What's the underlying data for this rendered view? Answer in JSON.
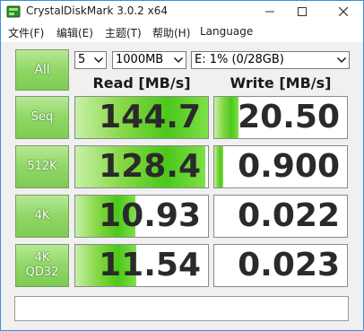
{
  "window": {
    "title": "CrystalDiskMark 3.0.2 x64"
  },
  "menu": [
    {
      "label": "文件(F)"
    },
    {
      "label": "编辑(E)"
    },
    {
      "label": "主题(T)"
    },
    {
      "label": "帮助(H)"
    },
    {
      "label": "Language"
    }
  ],
  "controls": {
    "all_button": "All",
    "count": "5",
    "size": "1000MB",
    "drive": "E: 1% (0/28GB)"
  },
  "columns": {
    "read": "Read [MB/s]",
    "write": "Write [MB/s]"
  },
  "rows": [
    {
      "label_line1": "Seq",
      "label_line2": "",
      "read": "144.7",
      "write": "20.50",
      "read_fill_pct": 100,
      "write_fill_pct": 18
    },
    {
      "label_line1": "512K",
      "label_line2": "",
      "read": "128.4",
      "write": "0.900",
      "read_fill_pct": 98,
      "write_fill_pct": 7
    },
    {
      "label_line1": "4K",
      "label_line2": "",
      "read": "10.93",
      "write": "0.022",
      "read_fill_pct": 45,
      "write_fill_pct": 0
    },
    {
      "label_line1": "4K",
      "label_line2": "QD32",
      "read": "11.54",
      "write": "0.023",
      "read_fill_pct": 46,
      "write_fill_pct": 0
    }
  ],
  "status_text": "",
  "colors": {
    "accent_green": "#4cc81a",
    "window_border": "#3c8fd8"
  }
}
